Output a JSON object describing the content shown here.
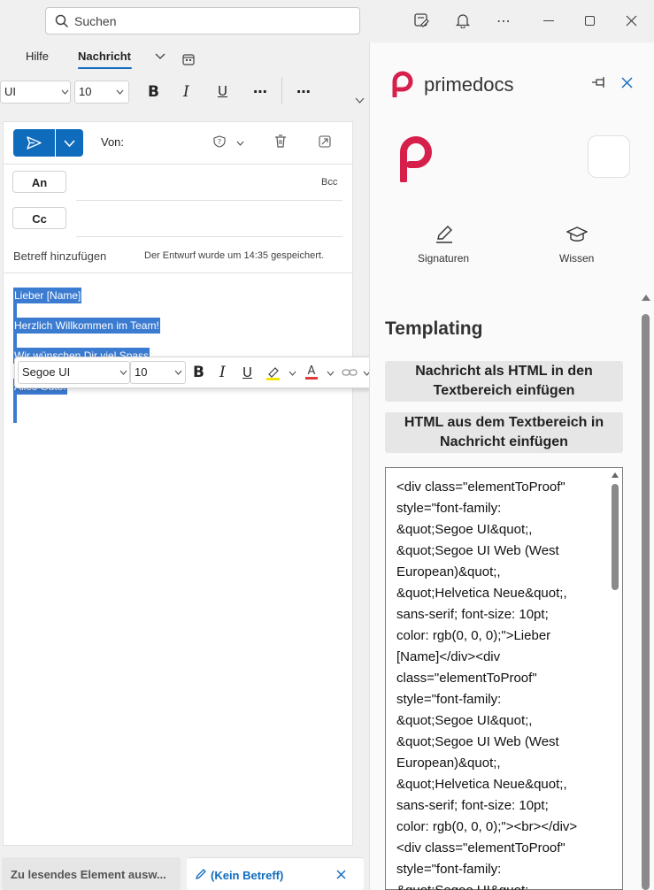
{
  "titlebar": {
    "search_placeholder": "Suchen"
  },
  "ribbon": {
    "tabs": [
      {
        "label": "Hilfe"
      },
      {
        "label": "Nachricht"
      }
    ],
    "font_name": "UI",
    "font_size": "10"
  },
  "compose": {
    "from_label": "Von:",
    "to_button": "An",
    "cc_button": "Cc",
    "bcc_label": "Bcc",
    "subject_placeholder": "Betreff hinzufügen",
    "draft_status": "Der Entwurf wurde um 14:35 gespeichert.",
    "body_lines": [
      "Lieber [Name]",
      "Herzlich Willkommen im Team!",
      "Wir wünschen Dir viel Spass",
      "Alles Gute!"
    ]
  },
  "floating_toolbar": {
    "font_name": "Segoe UI",
    "font_size": "10"
  },
  "bottom_tabs": {
    "read_item": "Zu lesendes Element ausw...",
    "draft_item": "(Kein Betreff)"
  },
  "panel": {
    "brand_name": "primedocs",
    "actions": [
      {
        "label": "Signaturen"
      },
      {
        "label": "Wissen"
      }
    ],
    "section_title": "Templating",
    "btn_insert_html_line1": "Nachricht als HTML in den",
    "btn_insert_html_line2": "Textbereich einfügen",
    "btn_html_to_msg_line1": "HTML aus dem Textbereich in",
    "btn_html_to_msg_line2": "Nachricht einfügen",
    "code": "<div class=\"elementToProof\"\nstyle=\"font-family:\n&quot;Segoe UI&quot;,\n&quot;Segoe UI Web (West\nEuropean)&quot;,\n&quot;Helvetica Neue&quot;,\nsans-serif; font-size: 10pt;\ncolor: rgb(0, 0, 0);\">Lieber\n[Name]</div><div\nclass=\"elementToProof\"\nstyle=\"font-family:\n&quot;Segoe UI&quot;,\n&quot;Segoe UI Web (West\nEuropean)&quot;,\n&quot;Helvetica Neue&quot;,\nsans-serif; font-size: 10pt;\ncolor: rgb(0, 0, 0);\"><br></div>\n<div class=\"elementToProof\"\nstyle=\"font-family:\n&quot;Segoe UI&quot;,"
  },
  "colors": {
    "accent": "#0f6cbd",
    "brand": "#d6204b",
    "selection": "#3b7bd0"
  }
}
